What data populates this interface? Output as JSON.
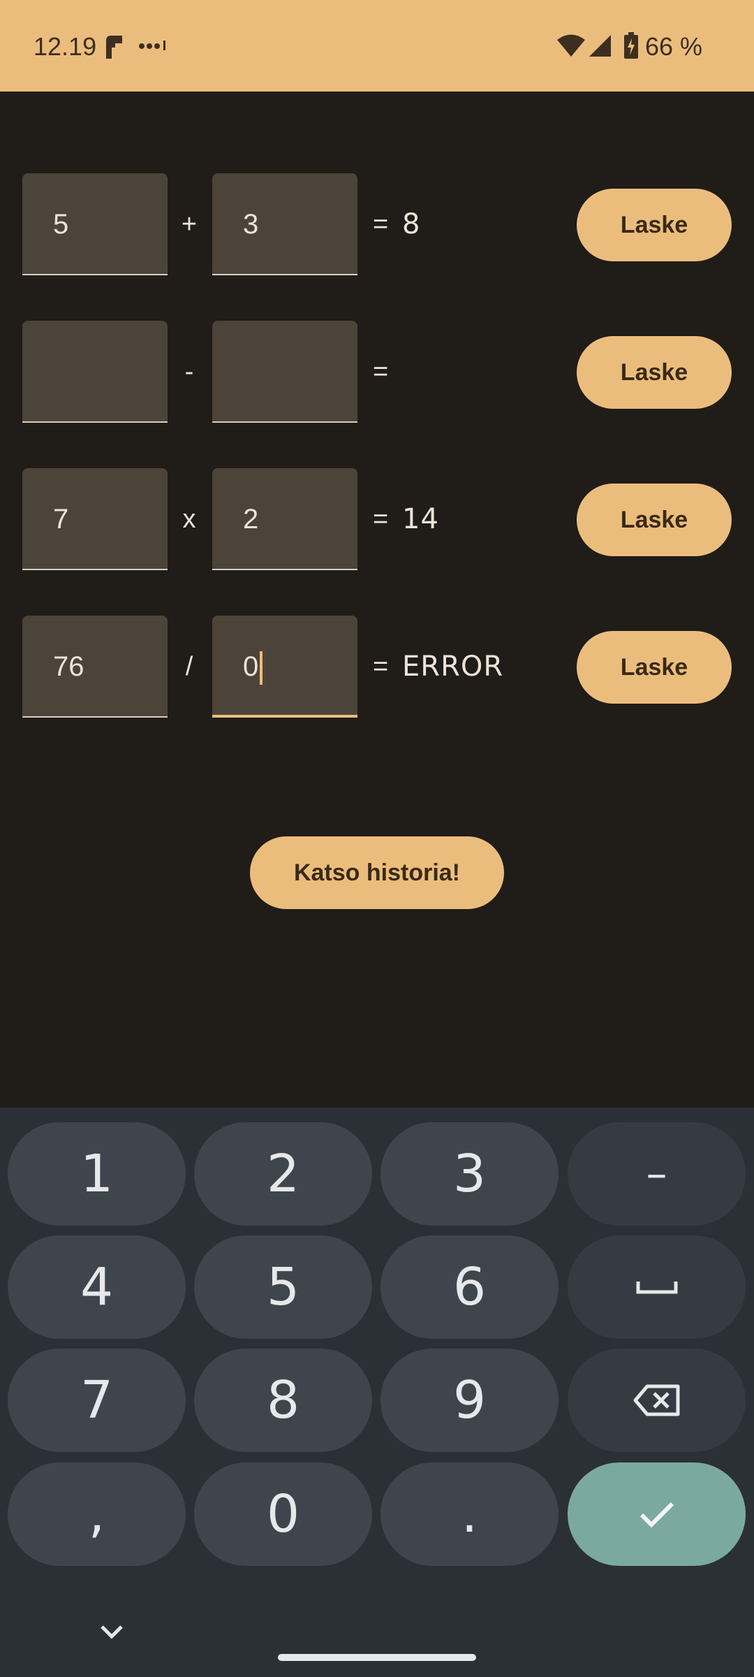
{
  "status_bar": {
    "time": "12.19",
    "battery_percent": "66 %",
    "background_color": "#ebbd7d"
  },
  "rows": [
    {
      "a": "5",
      "op": "+",
      "b": "3",
      "eq": "=",
      "result": "8",
      "button": "Laske"
    },
    {
      "a": "",
      "op": "-",
      "b": "",
      "eq": "=",
      "result": "",
      "button": "Laske"
    },
    {
      "a": "7",
      "op": "x",
      "b": "2",
      "eq": "=",
      "result": "14",
      "button": "Laske"
    },
    {
      "a": "76",
      "op": "/",
      "b": "0",
      "eq": "=",
      "result": "ERROR",
      "button": "Laske"
    }
  ],
  "history_button": "Katso historia!",
  "keyboard": {
    "keys": [
      "1",
      "2",
      "3",
      "–",
      "4",
      "5",
      "6",
      "space-icon",
      "7",
      "8",
      "9",
      "backspace-icon",
      ",",
      "0",
      ".",
      "check-icon"
    ],
    "digits": {
      "k1": "1",
      "k2": "2",
      "k3": "3",
      "k4": "4",
      "k5": "5",
      "k6": "6",
      "k7": "7",
      "k8": "8",
      "k9": "9",
      "k0": "0"
    },
    "minus": "–",
    "comma": ",",
    "period": "."
  },
  "colors": {
    "accent": "#ebbd7d",
    "background": "#201c18",
    "field": "#4d4439",
    "keyboard_bg": "#2b3036",
    "key": "#3f454d",
    "enter_key": "#7ba9a2"
  }
}
